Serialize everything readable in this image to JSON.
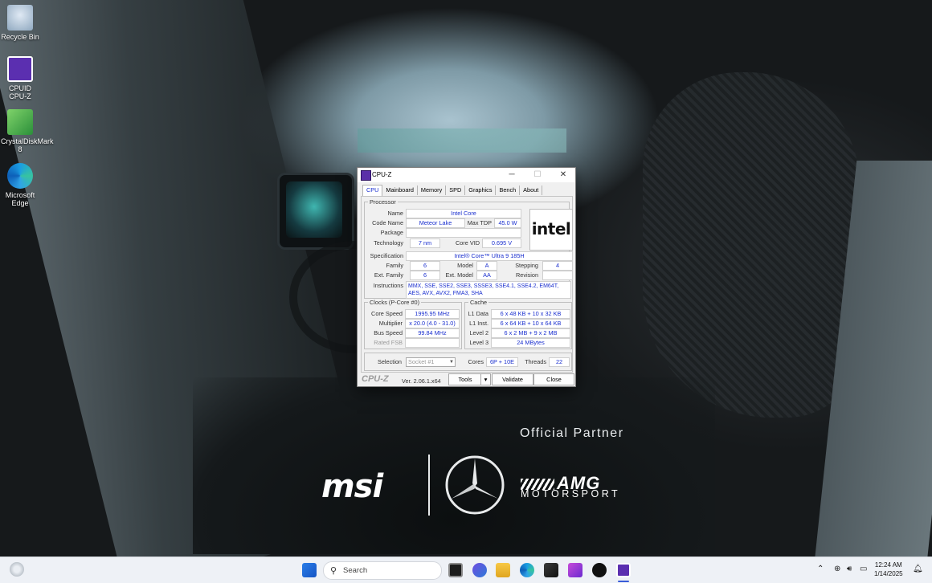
{
  "desktop": {
    "icons": [
      {
        "label": "Recycle Bin",
        "icon": "recycle-bin-icon"
      },
      {
        "label": "CPUID CPU-Z",
        "icon": "cpu-z-icon"
      },
      {
        "label": "CrystalDiskMark 8",
        "icon": "crystaldisk-icon"
      },
      {
        "label": "Microsoft Edge",
        "icon": "edge-icon"
      }
    ],
    "branding": {
      "partner": "Official Partner",
      "msi": "msi",
      "amg": "AMG",
      "motorsport": "MOTORSPORT"
    }
  },
  "window": {
    "title": "CPU-Z",
    "controls": {
      "minimize": "─",
      "maximize": "☐",
      "close": "✕"
    },
    "tabs": [
      "CPU",
      "Mainboard",
      "Memory",
      "SPD",
      "Graphics",
      "Bench",
      "About"
    ],
    "active_tab": "CPU",
    "processor": {
      "group_label": "Processor",
      "name_label": "Name",
      "name": "Intel Core",
      "codename_label": "Code Name",
      "codename": "Meteor Lake",
      "maxtdp_label": "Max TDP",
      "maxtdp": "45.0 W",
      "package_label": "Package",
      "package": "",
      "technology_label": "Technology",
      "technology": "7 nm",
      "corevid_label": "Core VID",
      "corevid": "0.695 V",
      "spec_label": "Specification",
      "spec": "Intel® Core™ Ultra 9 185H",
      "family_label": "Family",
      "family": "6",
      "model_label": "Model",
      "model": "A",
      "stepping_label": "Stepping",
      "stepping": "4",
      "extfamily_label": "Ext. Family",
      "extfamily": "6",
      "extmodel_label": "Ext. Model",
      "extmodel": "AA",
      "revision_label": "Revision",
      "revision": "",
      "instructions_label": "Instructions",
      "instructions": "MMX, SSE, SSE2, SSE3, SSSE3, SSE4.1, SSE4.2, EM64T, AES, AVX, AVX2, FMA3, SHA",
      "logo": "intel"
    },
    "clocks": {
      "group_label": "Clocks (P-Core #0)",
      "corespeed_label": "Core Speed",
      "corespeed": "1995.95 MHz",
      "multiplier_label": "Multiplier",
      "multiplier": "x 20.0 (4.0 - 31.0)",
      "busspeed_label": "Bus Speed",
      "busspeed": "99.84 MHz",
      "ratedfsb_label": "Rated FSB",
      "ratedfsb": ""
    },
    "cache": {
      "group_label": "Cache",
      "l1data_label": "L1 Data",
      "l1data": "6 x 48 KB + 10 x 32 KB",
      "l1inst_label": "L1 Inst.",
      "l1inst": "6 x 64 KB + 10 x 64 KB",
      "level2_label": "Level 2",
      "level2": "6 x 2 MB + 9 x 2 MB",
      "level3_label": "Level 3",
      "level3": "24 MBytes"
    },
    "selection": {
      "label": "Selection",
      "value": "Socket #1",
      "cores_label": "Cores",
      "cores": "6P + 10E",
      "threads_label": "Threads",
      "threads": "22"
    },
    "footer": {
      "logo": "CPU-Z",
      "version": "Ver. 2.06.1.x64",
      "tools": "Tools",
      "validate": "Validate",
      "close": "Close"
    }
  },
  "taskbar": {
    "search_placeholder": "Search",
    "time": "12:24 AM",
    "date": "1/14/2025",
    "colors": {
      "accent": "#3a5cd8",
      "background": "#eef1f6"
    }
  }
}
